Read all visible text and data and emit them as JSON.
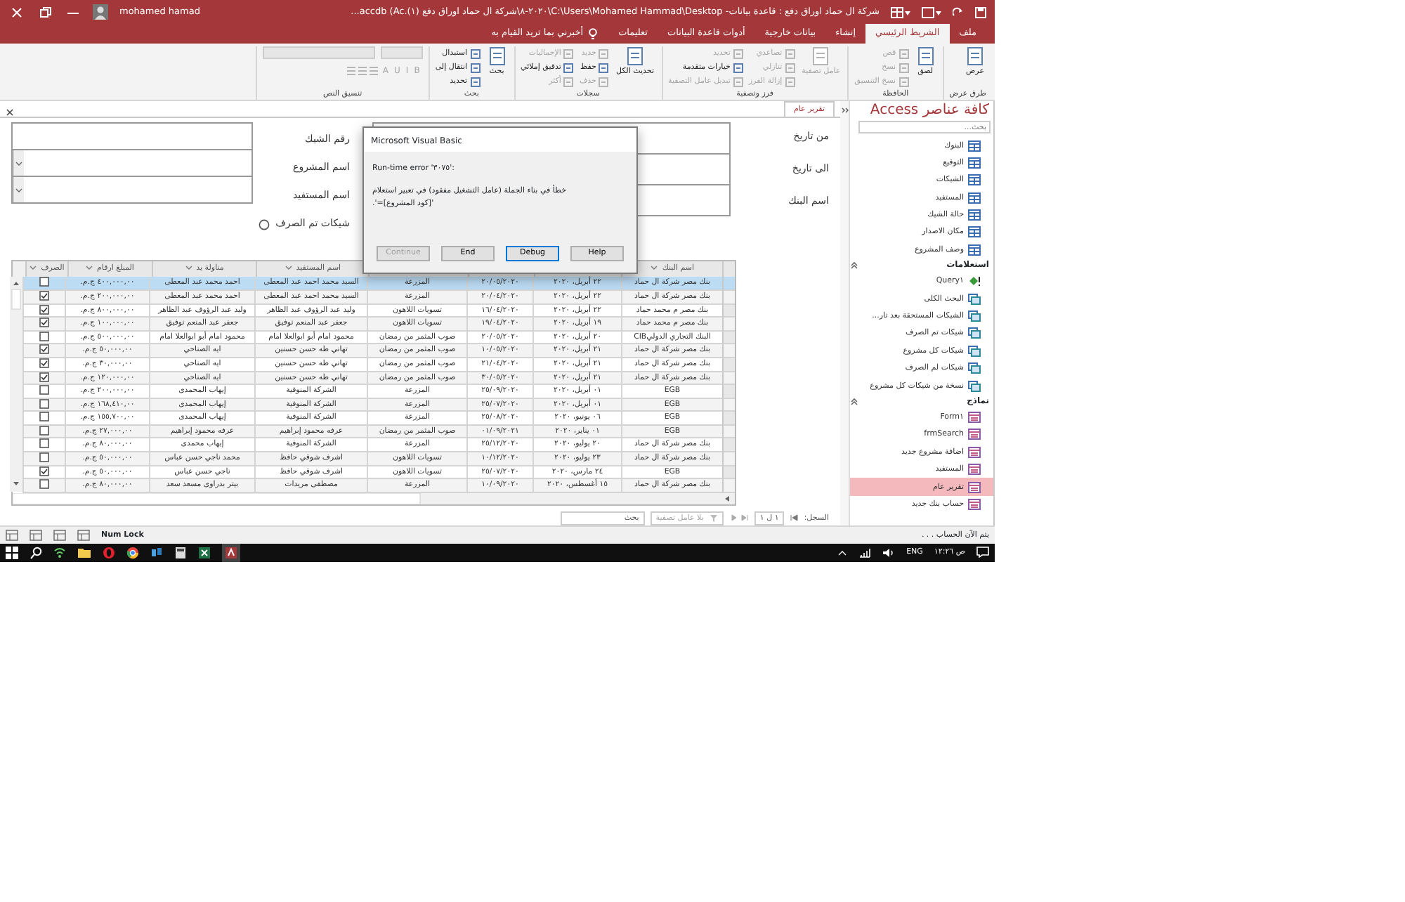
{
  "window": {
    "title": "شركة ال حماد اوراق دفع : قاعدة بيانات- C:\\Users\\Mohamed Hammad\\Desktop\\٢٠٢٠-٨\\شركة ال حماد اوراق دفع (١).accdb (Ac...",
    "user": "mohamed hamad"
  },
  "ribbon_tabs": [
    {
      "label": "ملف",
      "selected": false
    },
    {
      "label": "الشريط الرئيسي",
      "selected": true
    },
    {
      "label": "إنشاء",
      "selected": false
    },
    {
      "label": "بيانات خارجية",
      "selected": false
    },
    {
      "label": "أدوات قاعدة البيانات",
      "selected": false
    },
    {
      "label": "تعليمات",
      "selected": false
    }
  ],
  "tell_me": "أخبرني بما تريد القيام به",
  "ribbon_groups": [
    {
      "label": "طرق عرض",
      "items": [
        {
          "label": "عرض",
          "kind": "large",
          "disabled": false
        }
      ]
    },
    {
      "label": "الحافظة",
      "items": [
        {
          "label": "لصق",
          "kind": "large",
          "disabled": false
        },
        {
          "label": "قص",
          "kind": "small",
          "disabled": true
        },
        {
          "label": "نسخ",
          "kind": "small",
          "disabled": true
        },
        {
          "label": "نسخ التنسيق",
          "kind": "small",
          "disabled": true
        }
      ]
    },
    {
      "label": "فرز وتصفية",
      "items": [
        {
          "label": "عامل تصفية",
          "kind": "large",
          "disabled": true
        },
        {
          "label": "تصاعدي",
          "kind": "small",
          "disabled": true
        },
        {
          "label": "تنازلي",
          "kind": "small",
          "disabled": true
        },
        {
          "label": "إزالة الفرز",
          "kind": "small",
          "disabled": true
        },
        {
          "label": "تحديد",
          "kind": "small",
          "disabled": true
        },
        {
          "label": "خيارات متقدمة",
          "kind": "small",
          "disabled": false
        },
        {
          "label": "تبديل عامل التصفية",
          "kind": "small",
          "disabled": true
        }
      ]
    },
    {
      "label": "سجلات",
      "items": [
        {
          "label": "تحديث الكل",
          "kind": "large",
          "disabled": false
        },
        {
          "label": "جديد",
          "kind": "small",
          "disabled": true
        },
        {
          "label": "حفظ",
          "kind": "small",
          "disabled": false
        },
        {
          "label": "حذف",
          "kind": "small",
          "disabled": true
        },
        {
          "label": "الإجماليات",
          "kind": "small",
          "disabled": true
        },
        {
          "label": "تدقيق إملائي",
          "kind": "small",
          "disabled": false
        },
        {
          "label": "أكثر",
          "kind": "small",
          "disabled": true
        }
      ]
    },
    {
      "label": "بحث",
      "items": [
        {
          "label": "بحث",
          "kind": "large",
          "disabled": false
        },
        {
          "label": "استبدال",
          "kind": "small",
          "disabled": false
        },
        {
          "label": "انتقال إلى",
          "kind": "small",
          "disabled": false
        },
        {
          "label": "تحديد",
          "kind": "small",
          "disabled": false
        }
      ]
    },
    {
      "label": "تنسيق النص",
      "items": [
        {
          "label": "B",
          "kind": "format",
          "disabled": true
        },
        {
          "label": "I",
          "kind": "format",
          "disabled": true
        },
        {
          "label": "U",
          "kind": "format",
          "disabled": true
        },
        {
          "label": "A",
          "kind": "format",
          "disabled": true
        }
      ]
    }
  ],
  "document_tab": {
    "label": "تقرير عام"
  },
  "form": {
    "right_labels": [
      "من تاريخ",
      "الى تاريخ",
      "اسم البنك"
    ],
    "left_fields": [
      {
        "label": "رقم الشيك",
        "dropdown": false
      },
      {
        "label": "اسم المشروع",
        "dropdown": true
      },
      {
        "label": "اسم المستفيد",
        "dropdown": true
      }
    ],
    "option": {
      "label": "شيكات تم الصرف",
      "selected": false
    }
  },
  "datasheet": {
    "columns": [
      "اسم البنك",
      null,
      null,
      null,
      "اسم المستفيد",
      "مناولة يد",
      "المبلغ ارقام",
      "الصرف"
    ],
    "rows": [
      {
        "cells": [
          "بنك مصر شركة ال حماد",
          "٢٢ أبريل، ٢٠٢٠",
          "٢٠/٠٥/٢٠٢٠",
          "المزرعة",
          "السيد محمد احمد عبد المعطى",
          "احمد محمد عبد المعطى",
          "٤٠٠,٠٠٠,٠٠ ج.م."
        ],
        "paid": false,
        "selected": true
      },
      {
        "cells": [
          "بنك مصر شركة ال حماد",
          "٢٢ أبريل، ٢٠٢٠",
          "٢٠/٠٤/٢٠٢٠",
          "المزرعة",
          "السيد محمد احمد عبد المعطى",
          "احمد محمد عبد المعطى",
          "٢٠٠,٠٠٠,٠٠ ج.م."
        ],
        "paid": true,
        "selected": false
      },
      {
        "cells": [
          "بنك مصر م محمد حماد",
          "٢٢ أبريل، ٢٠٢٠",
          "١٦/٠٤/٢٠٢٠",
          "تسويات اللاهون",
          "وليد عبد الرؤوف عبد الظاهر",
          "وليد عبد الرؤوف عبد الظاهر",
          "٨٠٠,٠٠٠,٠٠ ج.م."
        ],
        "paid": true,
        "selected": false
      },
      {
        "cells": [
          "بنك مصر م محمد حماد",
          "١٩ أبريل، ٢٠٢٠",
          "١٩/٠٤/٢٠٢٠",
          "تسويات اللاهون",
          "جعفر عبد المنعم توفيق",
          "جعفر عبد المنعم توفيق",
          "١٠٠,٠٠٠,٠٠ ج.م."
        ],
        "paid": true,
        "selected": false
      },
      {
        "cells": [
          "البنك التجاري الدوليCIB",
          "٢٠ أبريل، ٢٠٢٠",
          "٢٠/٠٥/٢٠٢٠",
          "صوب المثمر من رمضان",
          "محمود امام أبو ابوالعلا امام",
          "محمود امام أبو ابوالعلا امام",
          "٥٠٠,٠٠٠,٠٠ ج.م."
        ],
        "paid": false,
        "selected": false
      },
      {
        "cells": [
          "بنك مصر شركة ال حماد",
          "٢١ أبريل، ٢٠٢٠",
          "١٠/٠٥/٢٠٢٠",
          "صوب المثمر من رمضان",
          "تهاني طه حسن حسنين",
          "ايه الصناحي",
          "٥٠,٠٠٠,٠٠ ج.م."
        ],
        "paid": true,
        "selected": false
      },
      {
        "cells": [
          "بنك مصر شركة ال حماد",
          "٢١ أبريل، ٢٠٢٠",
          "٢١/٠٤/٢٠٢٠",
          "صوب المثمر من رمضان",
          "تهاني طه حسن حسنين",
          "ايه الصناحي",
          "٣٠,٠٠٠,٠٠ ج.م."
        ],
        "paid": true,
        "selected": false
      },
      {
        "cells": [
          "بنك مصر شركة ال حماد",
          "٢١ أبريل، ٢٠٢٠",
          "٣٠/٠٥/٢٠٢٠",
          "صوب المثمر من رمضان",
          "تهاني طه حسن حسنين",
          "ايه الصناحي",
          "١٢٠,٠٠٠,٠٠ ج.م."
        ],
        "paid": true,
        "selected": false
      },
      {
        "cells": [
          "EGB",
          "٠١ أبريل، ٢٠٢٠",
          "٢٥/٠٩/٢٠٢٠",
          "المزرعة",
          "الشركة المنوفية",
          "إيهاب المحمدى",
          "٢٠٠,٠٠٠,٠٠ ج.م."
        ],
        "paid": false,
        "selected": false
      },
      {
        "cells": [
          "EGB",
          "٠١ أبريل، ٢٠٢٠",
          "٢٥/٠٧/٢٠٢٠",
          "المزرعة",
          "الشركة المنوفية",
          "إيهاب المحمدى",
          "١٦٨,٤١٠,٠٠ ج.م."
        ],
        "paid": false,
        "selected": false
      },
      {
        "cells": [
          "EGB",
          "٠٦ يونيو، ٢٠٢٠",
          "٢٥/٠٨/٢٠٢٠",
          "المزرعة",
          "الشركة المنوفية",
          "إيهاب المحمدى",
          "١٥٥,٧٠٠,٠٠ ج.م."
        ],
        "paid": false,
        "selected": false
      },
      {
        "cells": [
          "EGB",
          "٠١ يناير، ٢٠٢٠",
          "٠١/٠٩/٢٠٢١",
          "صوب المثمر من رمضان",
          "عرفه محمود إبراهيم",
          "عرفه محمود إبراهيم",
          "٢٧,٠٠٠,٠٠ ج.م."
        ],
        "paid": false,
        "selected": false
      },
      {
        "cells": [
          "بنك مصر شركة ال حماد",
          "٢٠ يوليو، ٢٠٢٠",
          "٢٥/١٢/٢٠٢٠",
          "المزرعة",
          "الشركة المنوفية",
          "إيهاب محمدى",
          "٨٠,٠٠٠,٠٠ ج.م."
        ],
        "paid": false,
        "selected": false
      },
      {
        "cells": [
          "بنك مصر شركة ال حماد",
          "٢٣ يوليو، ٢٠٢٠",
          "١٠/١٢/٢٠٢٠",
          "تسويات اللاهون",
          "اشرف شوقي حافظ",
          "محمد ناجي حسن عباس",
          "٥٠,٠٠٠,٠٠ ج.م."
        ],
        "paid": false,
        "selected": false
      },
      {
        "cells": [
          "EGB",
          "٢٤ مارس، ٢٠٢٠",
          "٢٥/٠٧/٢٠٢٠",
          "تسويات اللاهون",
          "اشرف شوقي حافظ",
          "ناجي حسن عباس",
          "٥٠,٠٠٠,٠٠ ج.م."
        ],
        "paid": true,
        "selected": false
      },
      {
        "cells": [
          "بنك مصر شركة ال حماد",
          "١٥ أغسطس، ٢٠٢٠",
          "١٠/٠٩/٢٠٢٠",
          "المزرعة",
          "مصطفى مريدات",
          "بيتر بدراوى مسعد سعد",
          "٨٠,٠٠٠,٠٠ ج.م."
        ],
        "paid": false,
        "selected": false
      }
    ]
  },
  "record_navigator": {
    "label": "السجل:",
    "position": "١ ل ١",
    "filter": "بلا عامل تصفية",
    "search": "بحث"
  },
  "navigation_pane": {
    "title": "كافة عناصر Access",
    "search_placeholder": "بحث...",
    "groups": [
      {
        "items": [
          {
            "label": "البنوك",
            "kind": "table",
            "selected": false
          },
          {
            "label": "التوقيع",
            "kind": "table",
            "selected": false
          },
          {
            "label": "الشيكات",
            "kind": "table",
            "selected": false
          },
          {
            "label": "المستفيد",
            "kind": "table",
            "selected": false
          },
          {
            "label": "حالة الشيك",
            "kind": "table",
            "selected": false
          },
          {
            "label": "مكان الاصدار",
            "kind": "table",
            "selected": false
          },
          {
            "label": "وصف المشروع",
            "kind": "table",
            "selected": false
          }
        ]
      },
      {
        "label": "استعلامات",
        "items": [
          {
            "label": "Query١",
            "kind": "action",
            "selected": false
          },
          {
            "label": "البحث الكلى",
            "kind": "query",
            "selected": false
          },
          {
            "label": "الشيكات المستحقة بعد تار...",
            "kind": "query",
            "selected": false
          },
          {
            "label": "شيكات تم الصرف",
            "kind": "query",
            "selected": false
          },
          {
            "label": "شيكات كل مشروع",
            "kind": "query",
            "selected": false
          },
          {
            "label": "شيكات لم الصرف",
            "kind": "query",
            "selected": false
          },
          {
            "label": "نسخة من شيكات كل مشروع",
            "kind": "query",
            "selected": false
          }
        ]
      },
      {
        "label": "نماذج",
        "items": [
          {
            "label": "Form١",
            "kind": "form",
            "selected": false
          },
          {
            "label": "frmSearch",
            "kind": "form",
            "selected": false
          },
          {
            "label": "اضافة مشروع جديد",
            "kind": "form",
            "selected": false
          },
          {
            "label": "المستفيد",
            "kind": "form",
            "selected": false
          },
          {
            "label": "تقرير عام",
            "kind": "form",
            "selected": true
          },
          {
            "label": "حساب بنك جديد",
            "kind": "form",
            "selected": false
          }
        ]
      }
    ]
  },
  "status_bar": {
    "num_lock": "Num Lock",
    "message": "يتم الآن الحساب . . ."
  },
  "dialog": {
    "title": "Microsoft Visual Basic",
    "error": "Run-time error '٣٠٧٥':",
    "message": "خطأ في بناء الجملة (عامل التشغيل مفقود) في تعبير استعلام '[كود المشروع]='.",
    "buttons": [
      {
        "label": "Help",
        "disabled": false,
        "focused": false
      },
      {
        "label": "Debug",
        "disabled": false,
        "focused": true
      },
      {
        "label": "End",
        "disabled": false,
        "focused": false
      },
      {
        "label": "Continue",
        "disabled": true,
        "focused": false
      }
    ]
  },
  "taskbar": {
    "language": "ENG",
    "time": "ص ١٢:٢٦"
  }
}
